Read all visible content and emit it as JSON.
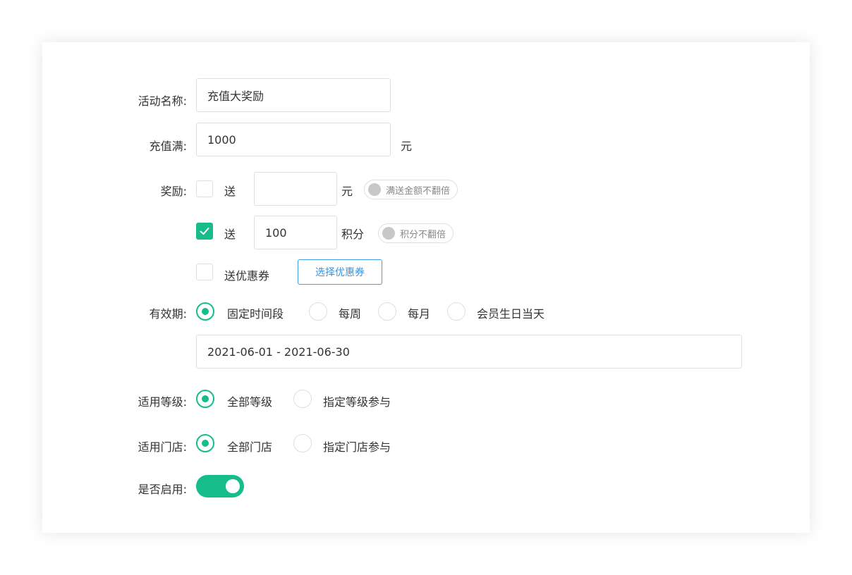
{
  "form": {
    "activity_name": {
      "label": "活动名称:",
      "value": "充值大奖励"
    },
    "recharge_full": {
      "label": "充值满:",
      "value": "1000",
      "unit": "元"
    },
    "reward": {
      "label": "奖励:",
      "cash": {
        "checked": false,
        "prefix": "送",
        "value": "",
        "unit": "元",
        "switch_label": "满送金额不翻倍",
        "switch_on": false
      },
      "points": {
        "checked": true,
        "prefix": "送",
        "value": "100",
        "unit": "积分",
        "switch_label": "积分不翻倍",
        "switch_on": false
      },
      "coupon": {
        "checked": false,
        "label": "送优惠券",
        "button": "选择优惠券"
      }
    },
    "validity": {
      "label": "有效期:",
      "options": [
        "固定时间段",
        "每周",
        "每月",
        "会员生日当天"
      ],
      "selected": 0,
      "date_range": "2021-06-01 - 2021-06-30"
    },
    "levels": {
      "label": "适用等级:",
      "options": [
        "全部等级",
        "指定等级参与"
      ],
      "selected": 0
    },
    "stores": {
      "label": "适用门店:",
      "options": [
        "全部门店",
        "指定门店参与"
      ],
      "selected": 0
    },
    "enabled": {
      "label": "是否启用:",
      "on": true
    }
  },
  "colors": {
    "accent": "#16bd8a",
    "link": "#3a93e0",
    "border": "#dcdfe6"
  }
}
